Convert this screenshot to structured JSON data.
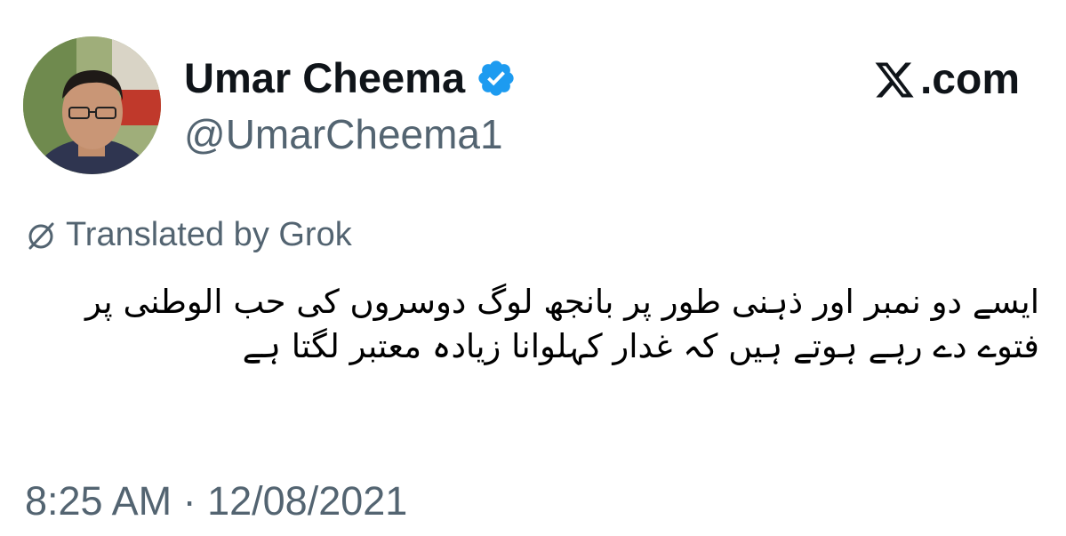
{
  "author": {
    "display_name": "Umar Cheema",
    "handle": "@UmarCheema1",
    "avatar_icon": "profile-photo",
    "verified_icon": "verified-badge-icon",
    "verified_color": "#1d9bf0"
  },
  "site": {
    "logo_text": ".com",
    "logo_icon": "x-logo-icon"
  },
  "translation": {
    "label": "Translated by Grok",
    "icon": "grok-icon"
  },
  "tweet": {
    "text": "ایسے دو نمبر اور ذہنی طور پر بانجھ لوگ دوسروں کی حب الوطنی پر فتوے دے رہے ہوتے ہیں کہ غدار کہلوانا زیادہ معتبر لگتا ہے"
  },
  "meta": {
    "timestamp": "8:25 AM · 12/08/2021"
  },
  "colors": {
    "text_primary": "#0f1419",
    "text_secondary": "#536471",
    "background": "#ffffff"
  }
}
